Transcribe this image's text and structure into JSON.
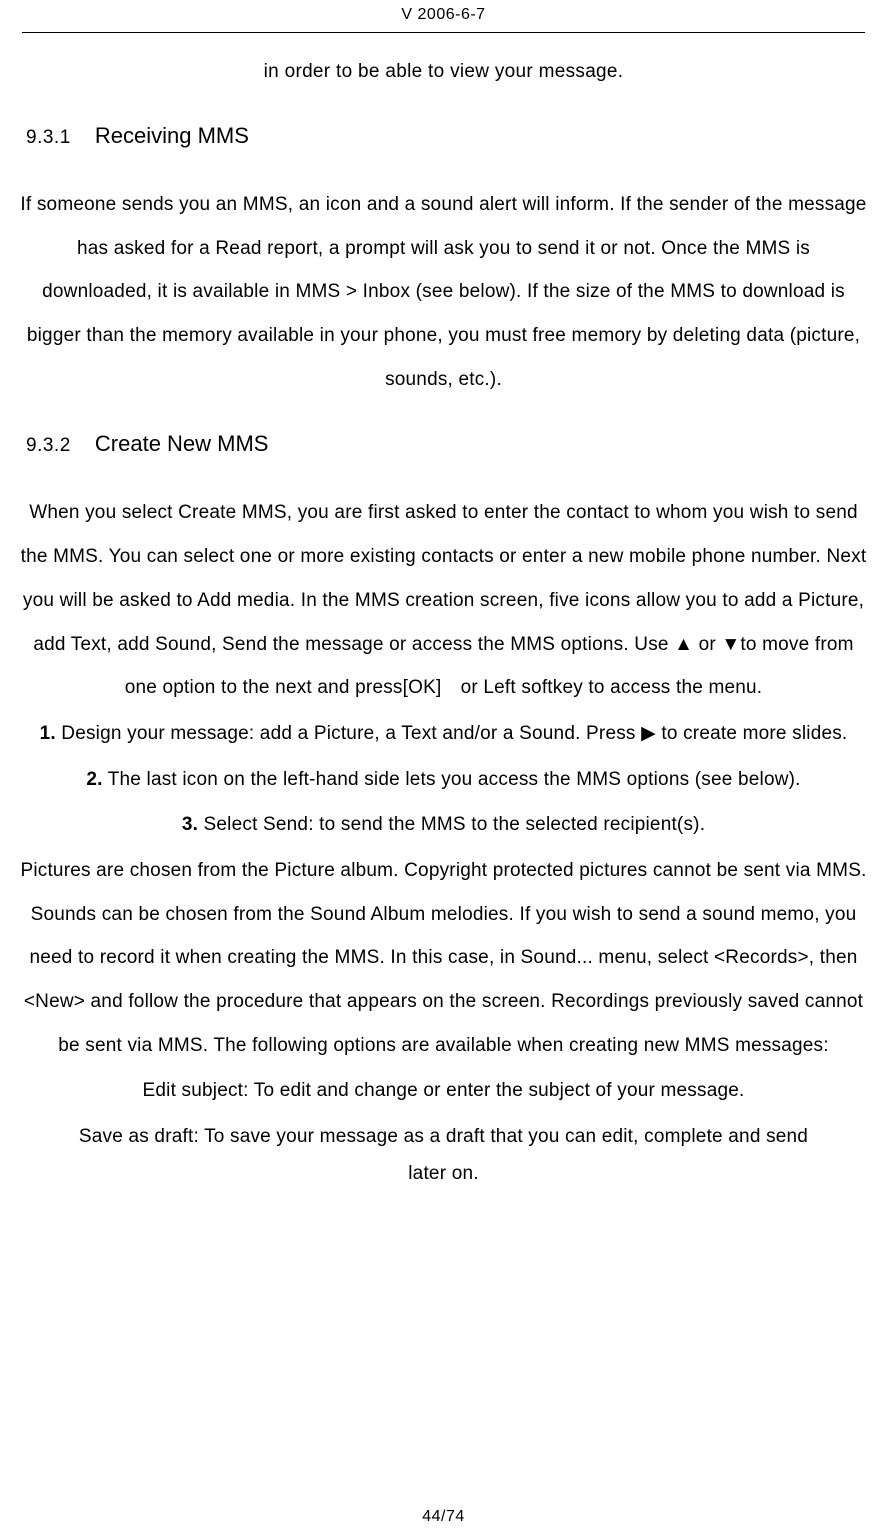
{
  "header": {
    "version": "V 2006-6-7"
  },
  "intro": "in order to be able to view your message.",
  "section1": {
    "num": "9.3.1",
    "title": "Receiving MMS",
    "body": "If someone sends you an MMS, an icon and a sound alert will inform. If the sender of the message has asked for a Read report, a prompt will ask you to send it or not. Once the MMS is downloaded, it is available in MMS > Inbox (see below). If the size of the MMS to download is bigger than the memory available in your phone, you must free memory by deleting data (picture, sounds, etc.)."
  },
  "section2": {
    "num": "9.3.2",
    "title": "Create New MMS",
    "body_part1": "When you select Create MMS, you are first asked to enter the contact to whom you wish to send the MMS. You can select one or more existing contacts or enter a new mobile phone number. Next you will be asked to Add media. In the MMS creation screen, five icons allow you to add a Picture, add Text, add Sound, Send the message or access the MMS options. Use ▲ or ▼to move from one option to the next and press[OK] or Left softkey to access the menu.",
    "li1_num": "1.",
    "li1_text": " Design your message: add a Picture, a Text and/or a Sound. Press  ▶  to create more slides.",
    "li2_num": "2.",
    "li2_text": " The last icon on the left-hand side lets you access the MMS options (see below).",
    "li3_num": "3.",
    "li3_text": " Select Send: to send the MMS to the selected recipient(s).",
    "body_part2": "Pictures are chosen from the Picture album. Copyright protected pictures cannot be sent via MMS. Sounds can be chosen from the Sound Album melodies. If you wish to send a sound memo, you need to record it when creating the MMS. In this case, in Sound... menu, select <Records>, then <New> and follow the procedure that appears on the screen. Recordings previously saved cannot be sent via MMS. The following options are available when creating new MMS messages:",
    "opt1": "Edit subject: To edit and change or enter the subject of your message.",
    "opt2": "Save as draft: To save your message as a draft that you can edit, complete and send",
    "cont": "later on."
  },
  "footer": {
    "page": "44/74"
  }
}
